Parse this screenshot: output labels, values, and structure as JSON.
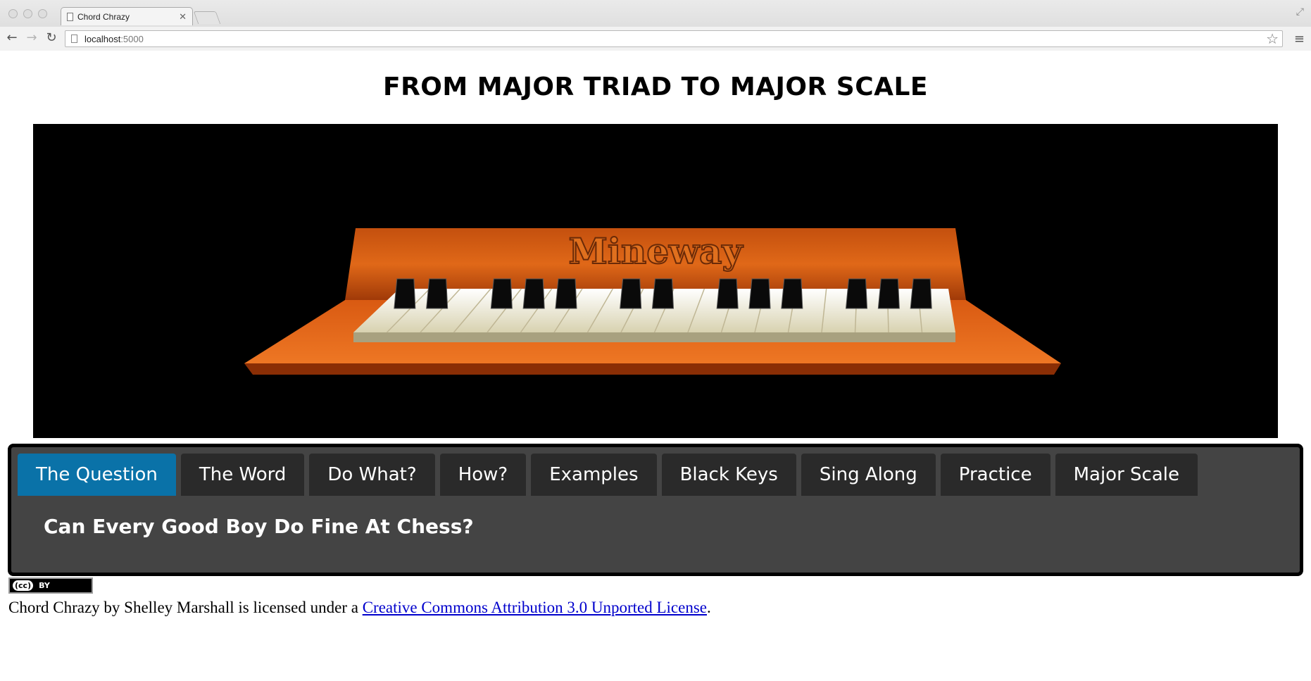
{
  "browser": {
    "tab_title": "Chord Chrazy",
    "url_host": "localhost",
    "url_port": ":5000"
  },
  "page": {
    "title": "FROM MAJOR TRIAD TO MAJOR SCALE"
  },
  "hero": {
    "logo_text": "Mineway"
  },
  "tabs": [
    {
      "label": "The Question",
      "active": true
    },
    {
      "label": "The Word",
      "active": false
    },
    {
      "label": "Do What?",
      "active": false
    },
    {
      "label": "How?",
      "active": false
    },
    {
      "label": "Examples",
      "active": false
    },
    {
      "label": "Black Keys",
      "active": false
    },
    {
      "label": "Sing Along",
      "active": false
    },
    {
      "label": "Practice",
      "active": false
    },
    {
      "label": "Major Scale",
      "active": false
    }
  ],
  "tab_content": {
    "text": "Can Every Good Boy Do Fine At Chess?"
  },
  "footer": {
    "badge_cc": "(cc)",
    "badge_by": "BY",
    "license_prefix": "Chord Chrazy by Shelley Marshall is licensed under a ",
    "license_link": "Creative Commons Attribution 3.0 Unported License",
    "license_suffix": "."
  },
  "colors": {
    "active_tab": "#0a72a8",
    "inactive_tab": "#2a2a2a",
    "panel_bg": "#444444",
    "link": "#0000cc"
  },
  "icons": [
    "back-icon",
    "forward-icon",
    "reload-icon",
    "page-icon",
    "star-icon",
    "menu-icon",
    "close-icon",
    "fullscreen-icon"
  ]
}
